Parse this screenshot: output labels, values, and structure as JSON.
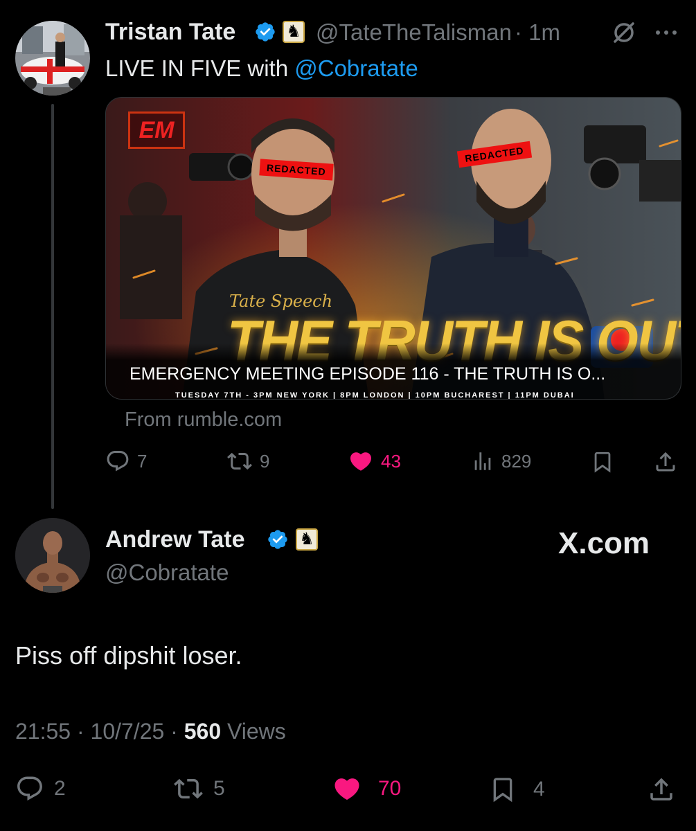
{
  "tweet1": {
    "name": "Tristan Tate",
    "handle": "@TateTheTalisman",
    "time": "· 1m",
    "text_prefix": "LIVE IN FIVE with ",
    "mention": "@Cobratate",
    "card": {
      "brand": "EM",
      "script_line": "Tate Speech",
      "headline": "THE TRUTH IS OUT",
      "redacted_label": "REDACTED",
      "title": "EMERGENCY MEETING EPISODE 116 - THE TRUTH IS O...",
      "strip": "TUESDAY 7TH - 3PM NEW YORK | 8PM LONDON | 10PM BUCHAREST | 11PM DUBAI"
    },
    "source": "From rumble.com",
    "actions": {
      "replies": "7",
      "reposts": "9",
      "likes": "43",
      "views": "829"
    }
  },
  "tweet2": {
    "name": "Andrew Tate",
    "handle": "@Cobratate",
    "text": "Piss off dipshit loser.",
    "watermark": "X.com",
    "time": "21:55",
    "date": "10/7/25",
    "views_count": "560",
    "views_label": "Views",
    "actions": {
      "replies": "2",
      "reposts": "5",
      "likes": "70",
      "bookmarks": "4"
    }
  },
  "colors": {
    "background": "#000000",
    "text": "#e7e9ea",
    "muted": "#71767b",
    "link": "#1d9bf0",
    "like": "#f91880",
    "verified": "#1d9bf0"
  },
  "icons": [
    "verified-icon",
    "knight-badge-icon",
    "grok-icon",
    "more-icon",
    "reply-icon",
    "repost-icon",
    "like-icon",
    "views-icon",
    "bookmark-icon",
    "share-icon"
  ]
}
